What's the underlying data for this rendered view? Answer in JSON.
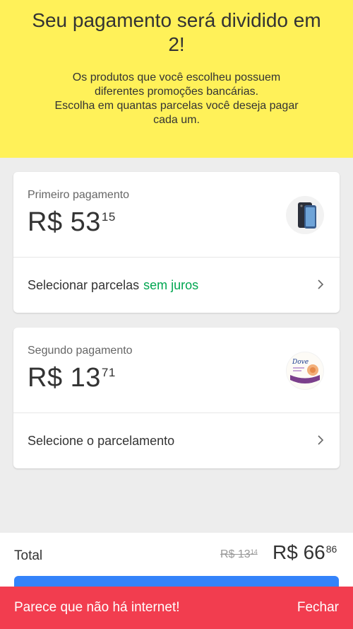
{
  "header": {
    "title": "Seu pagamento será dividido em 2!",
    "subtitle_line1": "Os produtos que você escolheu possuem",
    "subtitle_line2": "diferentes promoções bancárias.",
    "subtitle_line3": "Escolha em quantas parcelas você deseja pagar",
    "subtitle_line4": "cada um."
  },
  "payments": [
    {
      "label": "Primeiro pagamento",
      "amount_int": "R$ 53",
      "amount_cents": "15",
      "action_text": "Selecionar parcelas",
      "action_highlight": "sem juros",
      "thumbnail_icon": "smartphone-icon"
    },
    {
      "label": "Segundo pagamento",
      "amount_int": "R$ 13",
      "amount_cents": "71",
      "action_text": "Selecione o parcelamento",
      "action_highlight": "",
      "thumbnail_icon": "dove-product-icon",
      "thumbnail_brand": "Dove"
    }
  ],
  "total": {
    "label": "Total",
    "old_int": "R$ 13",
    "old_cents": "14",
    "new_int": "R$ 66",
    "new_cents": "86"
  },
  "snackbar": {
    "message": "Parece que não há internet!",
    "action": "Fechar"
  },
  "colors": {
    "header_bg": "#fff159",
    "accent_green": "#00a650",
    "cta_blue": "#3483fa",
    "error_red": "#f23d4f"
  }
}
